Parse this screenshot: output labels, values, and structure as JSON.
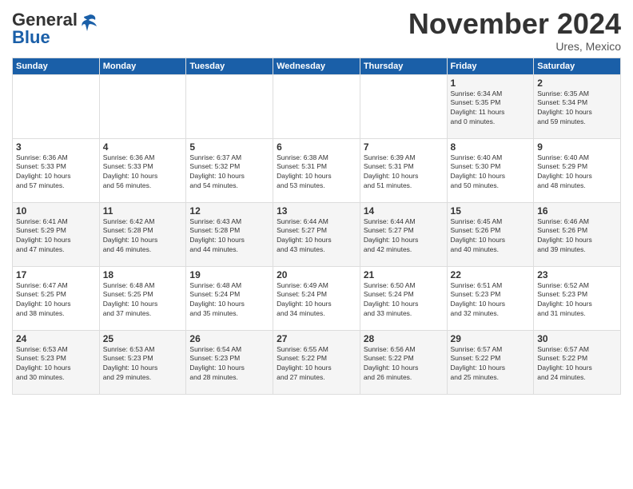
{
  "header": {
    "logo_general": "General",
    "logo_blue": "Blue",
    "month_title": "November 2024",
    "subtitle": "Ures, Mexico"
  },
  "days_of_week": [
    "Sunday",
    "Monday",
    "Tuesday",
    "Wednesday",
    "Thursday",
    "Friday",
    "Saturday"
  ],
  "weeks": [
    [
      {
        "day": "",
        "info": ""
      },
      {
        "day": "",
        "info": ""
      },
      {
        "day": "",
        "info": ""
      },
      {
        "day": "",
        "info": ""
      },
      {
        "day": "",
        "info": ""
      },
      {
        "day": "1",
        "info": "Sunrise: 6:34 AM\nSunset: 5:35 PM\nDaylight: 11 hours\nand 0 minutes."
      },
      {
        "day": "2",
        "info": "Sunrise: 6:35 AM\nSunset: 5:34 PM\nDaylight: 10 hours\nand 59 minutes."
      }
    ],
    [
      {
        "day": "3",
        "info": "Sunrise: 6:36 AM\nSunset: 5:33 PM\nDaylight: 10 hours\nand 57 minutes."
      },
      {
        "day": "4",
        "info": "Sunrise: 6:36 AM\nSunset: 5:33 PM\nDaylight: 10 hours\nand 56 minutes."
      },
      {
        "day": "5",
        "info": "Sunrise: 6:37 AM\nSunset: 5:32 PM\nDaylight: 10 hours\nand 54 minutes."
      },
      {
        "day": "6",
        "info": "Sunrise: 6:38 AM\nSunset: 5:31 PM\nDaylight: 10 hours\nand 53 minutes."
      },
      {
        "day": "7",
        "info": "Sunrise: 6:39 AM\nSunset: 5:31 PM\nDaylight: 10 hours\nand 51 minutes."
      },
      {
        "day": "8",
        "info": "Sunrise: 6:40 AM\nSunset: 5:30 PM\nDaylight: 10 hours\nand 50 minutes."
      },
      {
        "day": "9",
        "info": "Sunrise: 6:40 AM\nSunset: 5:29 PM\nDaylight: 10 hours\nand 48 minutes."
      }
    ],
    [
      {
        "day": "10",
        "info": "Sunrise: 6:41 AM\nSunset: 5:29 PM\nDaylight: 10 hours\nand 47 minutes."
      },
      {
        "day": "11",
        "info": "Sunrise: 6:42 AM\nSunset: 5:28 PM\nDaylight: 10 hours\nand 46 minutes."
      },
      {
        "day": "12",
        "info": "Sunrise: 6:43 AM\nSunset: 5:28 PM\nDaylight: 10 hours\nand 44 minutes."
      },
      {
        "day": "13",
        "info": "Sunrise: 6:44 AM\nSunset: 5:27 PM\nDaylight: 10 hours\nand 43 minutes."
      },
      {
        "day": "14",
        "info": "Sunrise: 6:44 AM\nSunset: 5:27 PM\nDaylight: 10 hours\nand 42 minutes."
      },
      {
        "day": "15",
        "info": "Sunrise: 6:45 AM\nSunset: 5:26 PM\nDaylight: 10 hours\nand 40 minutes."
      },
      {
        "day": "16",
        "info": "Sunrise: 6:46 AM\nSunset: 5:26 PM\nDaylight: 10 hours\nand 39 minutes."
      }
    ],
    [
      {
        "day": "17",
        "info": "Sunrise: 6:47 AM\nSunset: 5:25 PM\nDaylight: 10 hours\nand 38 minutes."
      },
      {
        "day": "18",
        "info": "Sunrise: 6:48 AM\nSunset: 5:25 PM\nDaylight: 10 hours\nand 37 minutes."
      },
      {
        "day": "19",
        "info": "Sunrise: 6:48 AM\nSunset: 5:24 PM\nDaylight: 10 hours\nand 35 minutes."
      },
      {
        "day": "20",
        "info": "Sunrise: 6:49 AM\nSunset: 5:24 PM\nDaylight: 10 hours\nand 34 minutes."
      },
      {
        "day": "21",
        "info": "Sunrise: 6:50 AM\nSunset: 5:24 PM\nDaylight: 10 hours\nand 33 minutes."
      },
      {
        "day": "22",
        "info": "Sunrise: 6:51 AM\nSunset: 5:23 PM\nDaylight: 10 hours\nand 32 minutes."
      },
      {
        "day": "23",
        "info": "Sunrise: 6:52 AM\nSunset: 5:23 PM\nDaylight: 10 hours\nand 31 minutes."
      }
    ],
    [
      {
        "day": "24",
        "info": "Sunrise: 6:53 AM\nSunset: 5:23 PM\nDaylight: 10 hours\nand 30 minutes."
      },
      {
        "day": "25",
        "info": "Sunrise: 6:53 AM\nSunset: 5:23 PM\nDaylight: 10 hours\nand 29 minutes."
      },
      {
        "day": "26",
        "info": "Sunrise: 6:54 AM\nSunset: 5:23 PM\nDaylight: 10 hours\nand 28 minutes."
      },
      {
        "day": "27",
        "info": "Sunrise: 6:55 AM\nSunset: 5:22 PM\nDaylight: 10 hours\nand 27 minutes."
      },
      {
        "day": "28",
        "info": "Sunrise: 6:56 AM\nSunset: 5:22 PM\nDaylight: 10 hours\nand 26 minutes."
      },
      {
        "day": "29",
        "info": "Sunrise: 6:57 AM\nSunset: 5:22 PM\nDaylight: 10 hours\nand 25 minutes."
      },
      {
        "day": "30",
        "info": "Sunrise: 6:57 AM\nSunset: 5:22 PM\nDaylight: 10 hours\nand 24 minutes."
      }
    ]
  ]
}
